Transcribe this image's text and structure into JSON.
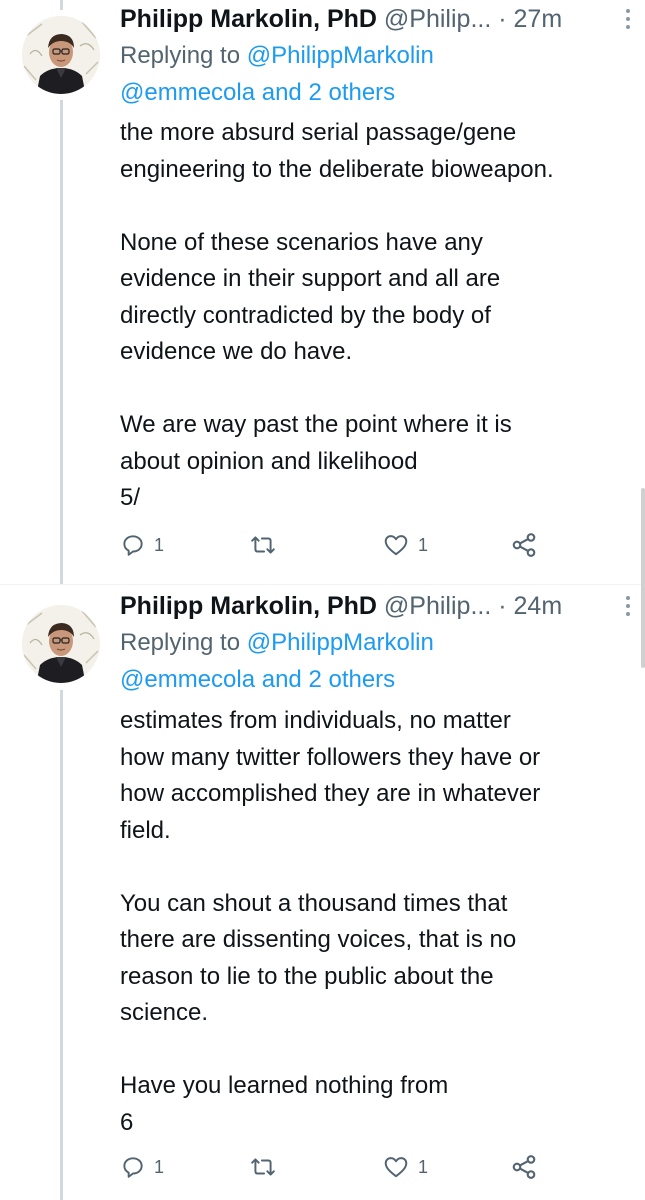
{
  "tweets": [
    {
      "author_name": "Philipp Markolin, PhD",
      "author_handle": "@Philip...",
      "separator": "·",
      "time": "27m",
      "replying_prefix": "Replying to",
      "replying_mention": "@PhilippMarkolin",
      "replying_others": "@emmecola and 2 others",
      "body": "the more absurd serial passage/gene\nengineering to the deliberate bioweapon.\n\nNone of these scenarios have any\nevidence in their support and all are\ndirectly contradicted by the body of\nevidence we do have.\n\nWe are way past the point where it is\nabout opinion and likelihood\n5/",
      "reply_count": "1",
      "retweet_count": "",
      "like_count": "1"
    },
    {
      "author_name": "Philipp Markolin, PhD",
      "author_handle": "@Philip...",
      "separator": "·",
      "time": "24m",
      "replying_prefix": "Replying to",
      "replying_mention": "@PhilippMarkolin",
      "replying_others": "@emmecola and 2 others",
      "body": "estimates from individuals, no matter\nhow many twitter followers they have or\nhow accomplished they are in whatever\nfield.\n\nYou can shout a thousand times that\nthere are dissenting voices, that is no\nreason to lie to the public about the\nscience.\n\nHave you learned nothing from\n6",
      "reply_count": "1",
      "retweet_count": "",
      "like_count": "1"
    }
  ],
  "icons": {
    "reply": "reply-icon",
    "retweet": "retweet-icon",
    "like": "heart-icon",
    "share": "share-icon",
    "more": "more-options-icon"
  },
  "colors": {
    "text": "#0f1419",
    "secondary": "#536471",
    "link": "#1d9bf0",
    "thread_line": "#cfd9de"
  }
}
